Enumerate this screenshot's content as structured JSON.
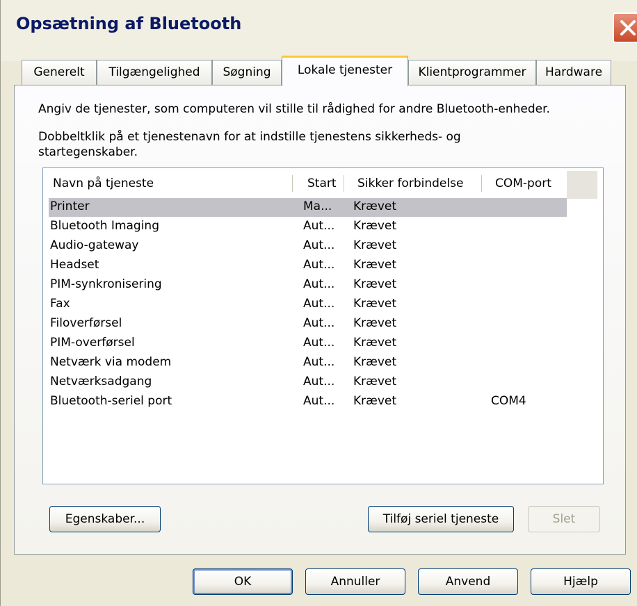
{
  "window": {
    "title": "Opsætning af Bluetooth"
  },
  "tabs": [
    {
      "label": "Generelt"
    },
    {
      "label": "Tilgængelighed"
    },
    {
      "label": "Søgning"
    },
    {
      "label": "Lokale tjenester",
      "active": true
    },
    {
      "label": "Klientprogrammer"
    },
    {
      "label": "Hardware"
    }
  ],
  "panel": {
    "description1": "Angiv de tjenester, som computeren vil stille til rådighed for andre Bluetooth-enheder.",
    "description2_line1": "Dobbeltklik på et tjenestenavn for at indstille tjenestens sikkerheds- og",
    "description2_line2": "startegenskaber."
  },
  "services_table": {
    "columns": [
      "Navn på tjeneste",
      "Start",
      "Sikker forbindelse",
      "COM-port"
    ],
    "rows": [
      {
        "name": "Printer",
        "start": "Ma...",
        "secure": "Krævet",
        "com": ""
      },
      {
        "name": "Bluetooth Imaging",
        "start": "Aut...",
        "secure": "Krævet",
        "com": ""
      },
      {
        "name": "Audio-gateway",
        "start": "Aut...",
        "secure": "Krævet",
        "com": ""
      },
      {
        "name": "Headset",
        "start": "Aut...",
        "secure": "Krævet",
        "com": ""
      },
      {
        "name": "PIM-synkronisering",
        "start": "Aut...",
        "secure": "Krævet",
        "com": ""
      },
      {
        "name": "Fax",
        "start": "Aut...",
        "secure": "Krævet",
        "com": ""
      },
      {
        "name": "Filoverførsel",
        "start": "Aut...",
        "secure": "Krævet",
        "com": ""
      },
      {
        "name": "PIM-overførsel",
        "start": "Aut...",
        "secure": "Krævet",
        "com": ""
      },
      {
        "name": "Netværk via modem",
        "start": "Aut...",
        "secure": "Krævet",
        "com": ""
      },
      {
        "name": "Netværksadgang",
        "start": "Aut...",
        "secure": "Krævet",
        "com": ""
      },
      {
        "name": "Bluetooth-seriel port",
        "start": "Aut...",
        "secure": "Krævet",
        "com": "COM4"
      }
    ],
    "selected_row": 0
  },
  "panel_buttons": {
    "properties": "Egenskaber...",
    "add_serial": "Tilføj seriel tjeneste",
    "delete": "Slet"
  },
  "dialog_buttons": {
    "ok": "OK",
    "cancel": "Annuller",
    "apply": "Anvend",
    "help": "Hjælp"
  },
  "colors": {
    "title_text": "#0b1a66",
    "active_tab_accent": "#ffc73c",
    "selected_row": "#c2c2c8",
    "close_button": "#c84a2a"
  }
}
